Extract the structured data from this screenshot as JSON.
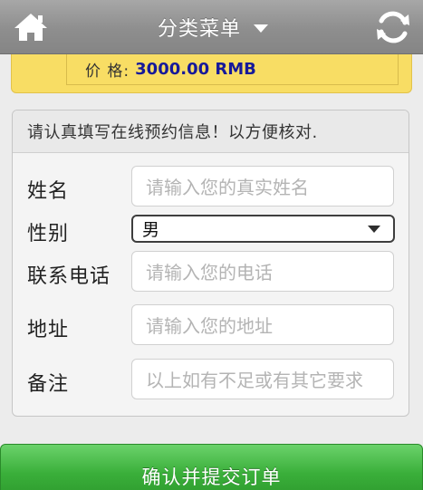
{
  "header": {
    "menu_title": "分类菜单",
    "home_icon": "home-icon",
    "refresh_icon": "refresh-icon"
  },
  "price": {
    "label": "价 格:",
    "value": "3000.00 RMB"
  },
  "form": {
    "intro": "请认真填写在线预约信息！以方便核对.",
    "fields": [
      {
        "label": "姓名",
        "placeholder": "请输入您的真实姓名"
      },
      {
        "label": "性别",
        "value": "男"
      },
      {
        "label": "联系电话",
        "placeholder": "请输入您的电话"
      },
      {
        "label": "地址",
        "placeholder": "请输入您的地址"
      },
      {
        "label": "备注",
        "placeholder": "以上如有不足或有其它要求"
      }
    ]
  },
  "submit": {
    "label": "确认并提交订单"
  },
  "colors": {
    "topbar": "#8e8e8e",
    "price_bg": "#f8dd64",
    "price_value": "#16199a",
    "submit_green": "#3aaf3a"
  }
}
